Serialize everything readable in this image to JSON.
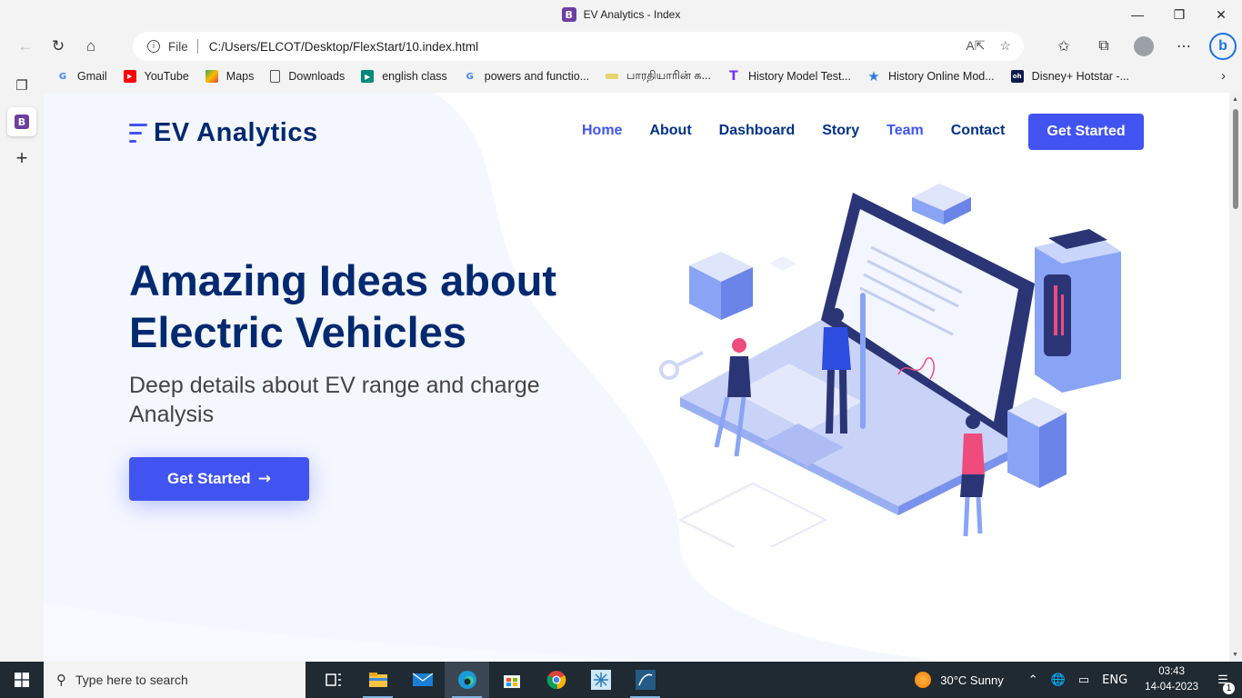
{
  "browser": {
    "tab_title": "EV Analytics - Index",
    "tab_favicon_letter": "B",
    "address_scheme_label": "File",
    "address_url": "C:/Users/ELCOT/Desktop/FlexStart/10.index.html",
    "favorites": [
      {
        "label": "Gmail",
        "icon": "google-icon",
        "color": "#4285f4"
      },
      {
        "label": "YouTube",
        "icon": "youtube-icon",
        "color": "#ff0000"
      },
      {
        "label": "Maps",
        "icon": "maps-icon",
        "color": "#34a853"
      },
      {
        "label": "Downloads",
        "icon": "page-icon",
        "color": "#555555"
      },
      {
        "label": "english class",
        "icon": "meet-icon",
        "color": "#00897b"
      },
      {
        "label": "powers and functio...",
        "icon": "google-icon",
        "color": "#4285f4"
      },
      {
        "label": "பாரதியாரின் க...",
        "icon": "site-icon",
        "color": "#c9a400"
      },
      {
        "label": "History Model Test...",
        "icon": "testbook-icon",
        "color": "#7b2ff7"
      },
      {
        "label": "History Online Mod...",
        "icon": "star-icon",
        "color": "#2d7be5"
      },
      {
        "label": "Disney+ Hotstar -...",
        "icon": "hotstar-icon",
        "color": "#0f1b4c"
      }
    ]
  },
  "site": {
    "brand": "EV Analytics",
    "nav": [
      {
        "label": "Home",
        "state": "active"
      },
      {
        "label": "About",
        "state": ""
      },
      {
        "label": "Dashboard",
        "state": ""
      },
      {
        "label": "Story",
        "state": ""
      },
      {
        "label": "Team",
        "state": "hover"
      },
      {
        "label": "Contact",
        "state": ""
      }
    ],
    "header_cta": "Get Started",
    "hero_title": "Amazing Ideas about Electric Vehicles",
    "hero_subtitle": "Deep details about EV range and charge Analysis",
    "hero_cta": "Get Started",
    "accent_color": "#4154f1",
    "heading_color": "#012970"
  },
  "taskbar": {
    "search_placeholder": "Type here to search",
    "weather": "30°C  Sunny",
    "language": "ENG",
    "time": "03:43",
    "date": "14-04-2023",
    "notification_count": "1"
  }
}
